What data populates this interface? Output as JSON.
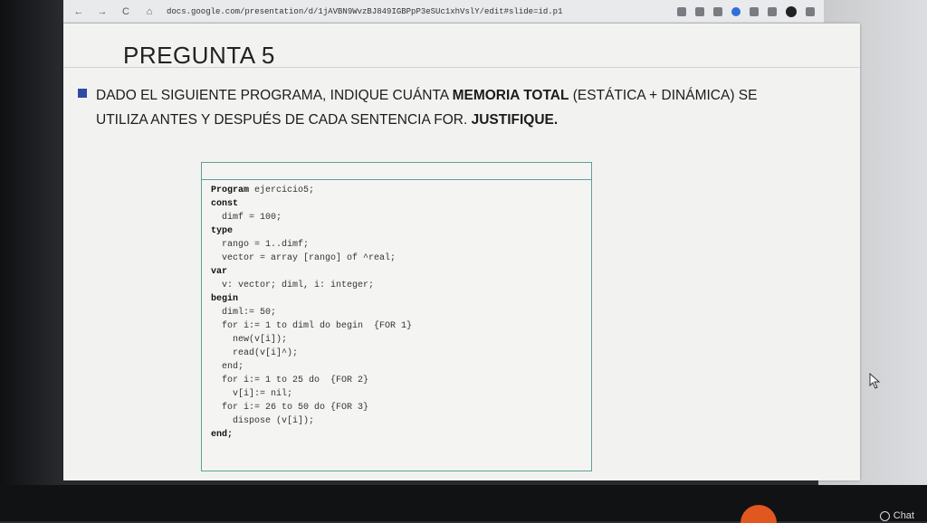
{
  "browser": {
    "back": "←",
    "forward": "→",
    "reload": "C",
    "home": "⌂",
    "url": "docs.google.com/presentation/d/1jAVBN9WvzBJ849IGBPpP3eSUc1xhVslY/edit#slide=id.p1"
  },
  "slide": {
    "title": "PREGUNTA 5",
    "question_part1": "DADO EL SIGUIENTE PROGRAMA, INDIQUE CUÁNTA ",
    "question_bold1": "MEMORIA TOTAL",
    "question_part2": " (ESTÁTICA + DINÁMICA) SE UTILIZA ANTES Y DESPUÉS DE CADA SENTENCIA FOR. ",
    "question_bold2": "JUSTIFIQUE.",
    "code_lines": [
      {
        "kw": "Program",
        "text": " ejercicio5;"
      },
      {
        "kw": "const",
        "text": ""
      },
      {
        "kw": "",
        "text": "  dimf = 100;"
      },
      {
        "kw": "type",
        "text": ""
      },
      {
        "kw": "",
        "text": "  rango = 1..dimf;"
      },
      {
        "kw": "",
        "text": "  vector = array [rango] of ^real;"
      },
      {
        "kw": "var",
        "text": ""
      },
      {
        "kw": "",
        "text": "  v: vector; diml, i: integer;"
      },
      {
        "kw": "begin",
        "text": ""
      },
      {
        "kw": "",
        "text": "  diml:= 50;"
      },
      {
        "kw": "",
        "text": "  for i:= 1 to diml do begin  {FOR 1}"
      },
      {
        "kw": "",
        "text": "    new(v[i]);"
      },
      {
        "kw": "",
        "text": "    read(v[i]^);"
      },
      {
        "kw": "",
        "text": "  end;"
      },
      {
        "kw": "",
        "text": "  for i:= 1 to 25 do  {FOR 2}"
      },
      {
        "kw": "",
        "text": "    v[i]:= nil;"
      },
      {
        "kw": "",
        "text": "  for i:= 26 to 50 do {FOR 3}"
      },
      {
        "kw": "",
        "text": "    dispose (v[i]);"
      },
      {
        "kw": "end;",
        "text": ""
      }
    ]
  },
  "taskbar": {
    "chat_label": "Chat"
  },
  "colors": {
    "bullet": "#2e4aa4",
    "code_border": "#5f9e9a",
    "chat_accent": "#e0571f"
  }
}
